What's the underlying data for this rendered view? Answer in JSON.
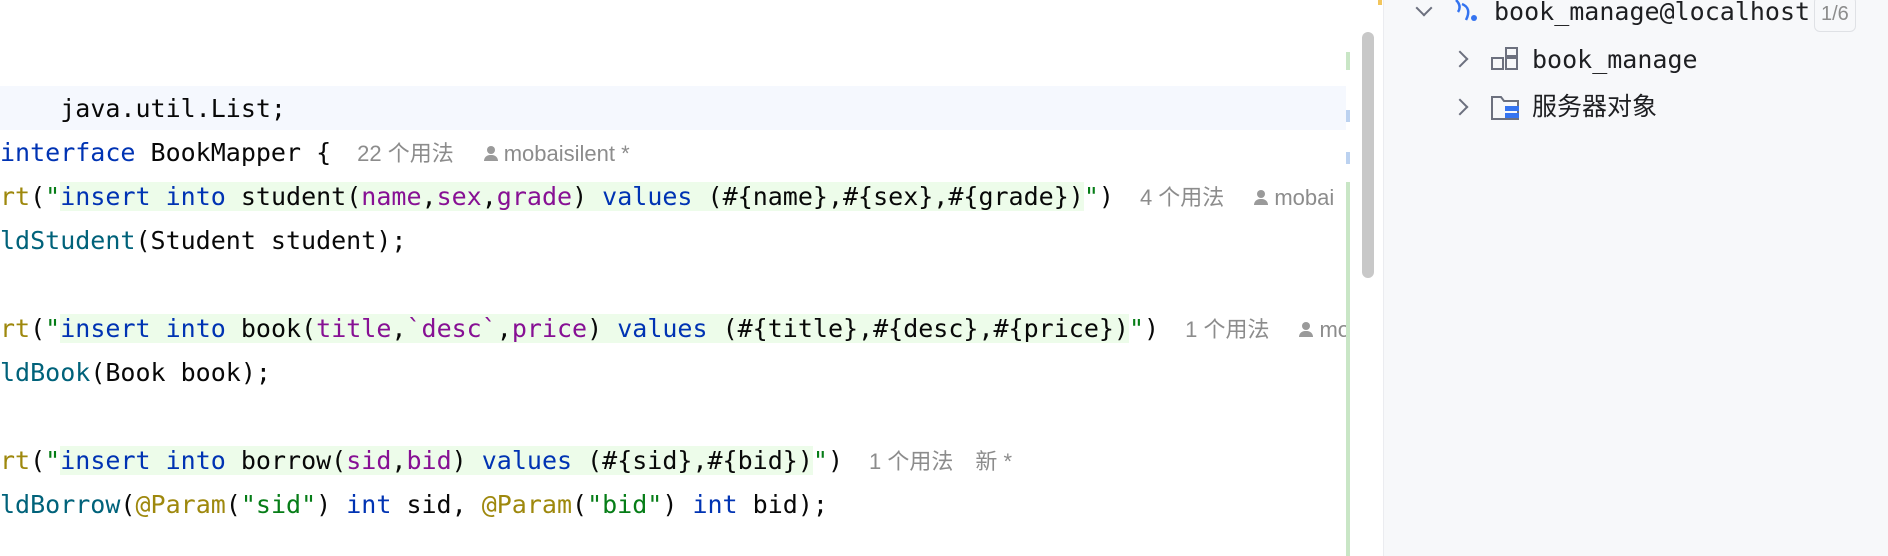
{
  "code": {
    "line1": {
      "a": "java.util.List;"
    },
    "line2": {
      "kw": "interface",
      "name": " BookMapper {",
      "hint": "22 个用法",
      "author": "mobaisilent *"
    },
    "line3": {
      "ann": "rt",
      "p1": "(",
      "q1": "\"",
      "kw1": "insert",
      "s1": " ",
      "kw2": "into",
      "s2": " student(",
      "c1": "name",
      "x1": ",",
      "c2": "sex",
      "x2": ",",
      "c3": "grade",
      "x3": ") ",
      "kw3": "values",
      "tail": " (#{name},#{sex},#{grade})",
      "q2": "\"",
      "p2": ")",
      "hint": "4 个用法",
      "author": "mobai"
    },
    "line4": {
      "meth": "ldStudent",
      "rest": "(Student student);"
    },
    "line5": {
      "ann": "rt",
      "p1": "(",
      "q1": "\"",
      "kw1": "insert",
      "s1": " ",
      "kw2": "into",
      "s2": " book(",
      "c1": "title",
      "x1": ",",
      "c2": "`desc`",
      "x2": ",",
      "c3": "price",
      "x3": ") ",
      "kw3": "values",
      "tail": " (#{title},#{desc},#{price})",
      "q2": "\"",
      "p2": ")",
      "hint": "1 个用法",
      "author": "mo"
    },
    "line6": {
      "meth": "ldBook",
      "rest": "(Book book);"
    },
    "line7": {
      "ann": "rt",
      "p1": "(",
      "q1": "\"",
      "kw1": "insert",
      "s1": " ",
      "kw2": "into",
      "s2": " borrow(",
      "c1": "sid",
      "x1": ",",
      "c2": "bid",
      "x3": ") ",
      "kw3": "values",
      "tail": " (#{sid},#{bid})",
      "q2": "\"",
      "p2": ")",
      "hint": "1 个用法",
      "new": "新 *"
    },
    "line8": {
      "meth": "ldBorrow",
      "p1": "(",
      "ann1": "@Param",
      "s1": "(",
      "str1": "\"sid\"",
      "s2": ") ",
      "kw1": "int",
      "s3": " sid, ",
      "ann2": "@Param",
      "s4": "(",
      "str2": "\"bid\"",
      "s5": ") ",
      "kw2": "int",
      "s6": " bid);"
    }
  },
  "db_panel": {
    "root": {
      "label": "book_manage@localhost",
      "count": "1/6",
      "icon": "datasource-icon"
    },
    "children": [
      {
        "label": "book_manage",
        "icon": "schema-icon"
      },
      {
        "label": "服务器对象",
        "icon": "server-objects-folder-icon"
      }
    ]
  },
  "colors": {
    "keyword": "#0033b3",
    "annotation": "#9e880d",
    "string": "#067d17",
    "column": "#871094",
    "method": "#00627a",
    "hint": "#8c8c8c"
  }
}
